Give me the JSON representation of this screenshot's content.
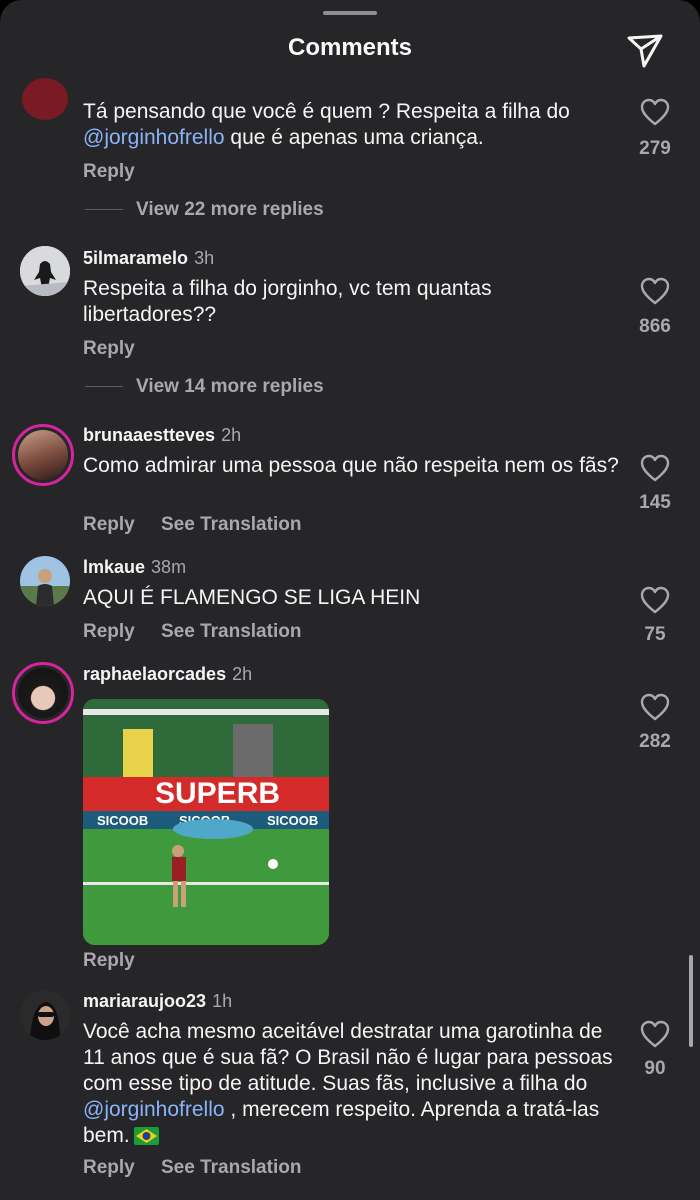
{
  "header": {
    "title": "Comments",
    "share_icon": "send-icon"
  },
  "comments": [
    {
      "username": "",
      "time": "",
      "text_parts": [
        "Tá pensando que você é quem ? Respeita a filha do ",
        "@jorginhofrello",
        " que é apenas uma criança."
      ],
      "likes": "279",
      "reply": "Reply",
      "view_more": "View 22 more replies"
    },
    {
      "username": "5ilmaramelo",
      "time": "3h",
      "text": "Respeita a filha do jorginho, vc tem quantas libertadores??",
      "likes": "866",
      "reply": "Reply",
      "view_more": "View 14 more replies"
    },
    {
      "username": "brunaaestteves",
      "time": "2h",
      "text": "Como admirar uma pessoa que não respeita nem os fãs?",
      "likes": "145",
      "reply": "Reply",
      "translate": "See Translation"
    },
    {
      "username": "lmkaue",
      "time": "38m",
      "text": "AQUI É FLAMENGO SE LIGA HEIN",
      "likes": "75",
      "reply": "Reply",
      "translate": "See Translation"
    },
    {
      "username": "raphaelaorcades",
      "time": "2h",
      "media_text": [
        "SUPERB",
        "SICOOB",
        "SICOOB",
        "SICOOB"
      ],
      "likes": "282",
      "reply": "Reply"
    },
    {
      "username": "mariaraujoo23",
      "time": "1h",
      "text_parts": [
        "Você acha mesmo aceitável destratar uma garotinha de 11 anos que é sua fã? O Brasil não é lugar para pessoas com esse tipo de atitude. Suas fãs, inclusive a filha do ",
        "@jorginhofrello",
        " , merecem respeito. Aprenda a tratá-las bem."
      ],
      "emoji": "brazil-flag-icon",
      "likes": "90",
      "reply": "Reply",
      "translate": "See Translation"
    }
  ]
}
